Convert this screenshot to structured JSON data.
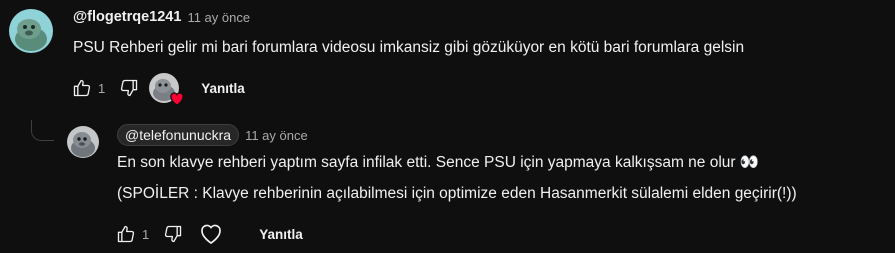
{
  "comment": {
    "author": "@flogetrqe1241",
    "time": "11 ay önce",
    "text": "PSU Rehberi gelir mi bari forumlara videosu imkansiz gibi gözüküyor en kötü bari forumlara gelsin",
    "like_count": "1",
    "reply_label": "Yanıtla",
    "avatar_icon": "seal-avatar-icon",
    "creator_heart": true
  },
  "reply": {
    "author": "@telefonunuckra",
    "time": "11 ay önce",
    "text_lines": [
      "En son klavye rehberi yaptım sayfa infilak etti. Sence PSU için yapmaya kalkışsam ne olur 👀",
      "(SPOİLER : Klavye rehberinin açılabilmesi için optimize eden Hasanmerkit sülalemi elden geçirir(!))"
    ],
    "like_count": "1",
    "reply_label": "Yanıtla",
    "avatar_icon": "creator-avatar-icon"
  },
  "colors": {
    "background": "#0f0f0f",
    "text": "#f1f1f1",
    "secondary_text": "#aaaaaa",
    "heart": "#ff0033",
    "chip_background": "#272727"
  }
}
